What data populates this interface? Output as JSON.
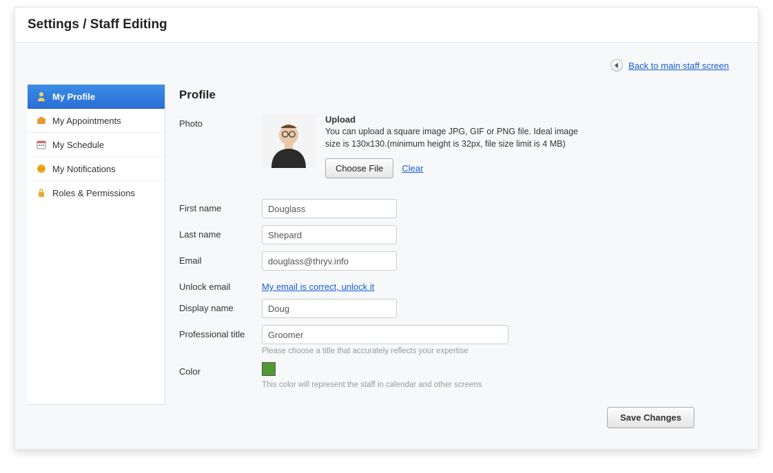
{
  "header": {
    "title": "Settings / Staff Editing"
  },
  "back": {
    "label": "Back to main staff screen"
  },
  "sidebar": {
    "items": [
      {
        "label": "My Profile",
        "icon": "user-icon",
        "active": true
      },
      {
        "label": "My Appointments",
        "icon": "briefcase-icon",
        "active": false
      },
      {
        "label": "My Schedule",
        "icon": "calendar-icon",
        "active": false
      },
      {
        "label": "My Notifications",
        "icon": "globe-icon",
        "active": false
      },
      {
        "label": "Roles & Permissions",
        "icon": "lock-icon",
        "active": false
      }
    ]
  },
  "profile": {
    "section_title": "Profile",
    "labels": {
      "photo": "Photo",
      "first_name": "First name",
      "last_name": "Last name",
      "email": "Email",
      "unlock_email": "Unlock email",
      "display_name": "Display name",
      "professional_title": "Professional title",
      "color": "Color"
    },
    "photo": {
      "upload_title": "Upload",
      "upload_desc": "You can upload a square image JPG, GIF or PNG file. Ideal image size is 130x130.(minimum height is 32px, file size limit is 4 MB)",
      "choose_file": "Choose File",
      "clear": "Clear"
    },
    "values": {
      "first_name": "Douglass",
      "last_name": "Shepard",
      "email": "douglass@thryv.info",
      "unlock_link": "My email is correct, unlock it",
      "display_name": "Doug",
      "professional_title": "Groomer",
      "color": "#4f9a33"
    },
    "hints": {
      "title": "Please choose a title that accurately reflects your expertise",
      "color": "This color will represent the staff in calendar and other screens"
    },
    "save": "Save Changes"
  }
}
